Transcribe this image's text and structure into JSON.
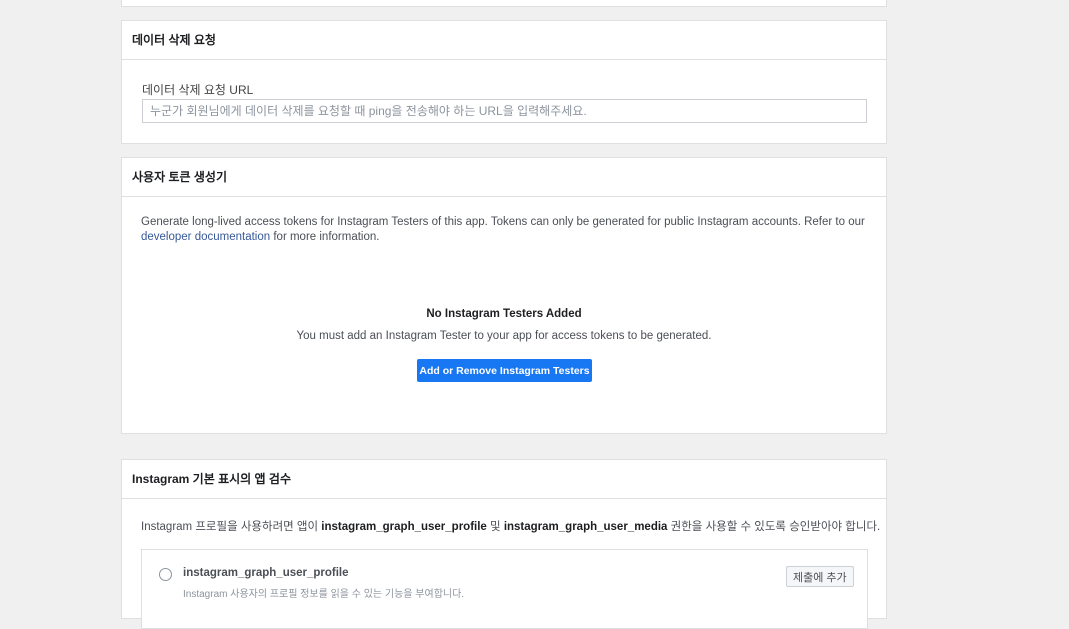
{
  "data_deletion": {
    "header": "데이터 삭제 요청",
    "field_label": "데이터 삭제 요청 URL",
    "input_value": "",
    "input_placeholder": "누군가 회원님에게 데이터 삭제를 요청할 때 ping을 전송해야 하는 URL을 입력해주세요."
  },
  "token_generator": {
    "header": "사용자 토큰 생성기",
    "description_pre": "Generate long-lived access tokens for Instagram Testers of this app. Tokens can only be generated for public Instagram accounts. Refer to our ",
    "doc_link": "developer documentation",
    "description_post": " for more information.",
    "empty_title": "No Instagram Testers Added",
    "empty_subtitle": "You must add an Instagram Tester to your app for access tokens to be generated.",
    "button_label": "Add or Remove Instagram Testers"
  },
  "app_review": {
    "header": "Instagram 기본 표시의 앱 검수",
    "desc_part1": "Instagram 프로필을 사용하려면 앱이 ",
    "perm1": "instagram_graph_user_profile",
    "desc_part2": " 및 ",
    "perm2": "instagram_graph_user_media",
    "desc_part3": " 권한을 사용할 수 있도록 승인받아야 합니다.",
    "permissions": [
      {
        "name": "instagram_graph_user_profile",
        "description": "Instagram 사용자의 프로필 정보를 읽을 수 있는 기능을 부여합니다.",
        "button_label": "제출에 추가"
      }
    ]
  },
  "colors": {
    "background": "#f0f0f0",
    "primary": "#1877f2",
    "link": "#385898",
    "border": "#dddfe2"
  }
}
